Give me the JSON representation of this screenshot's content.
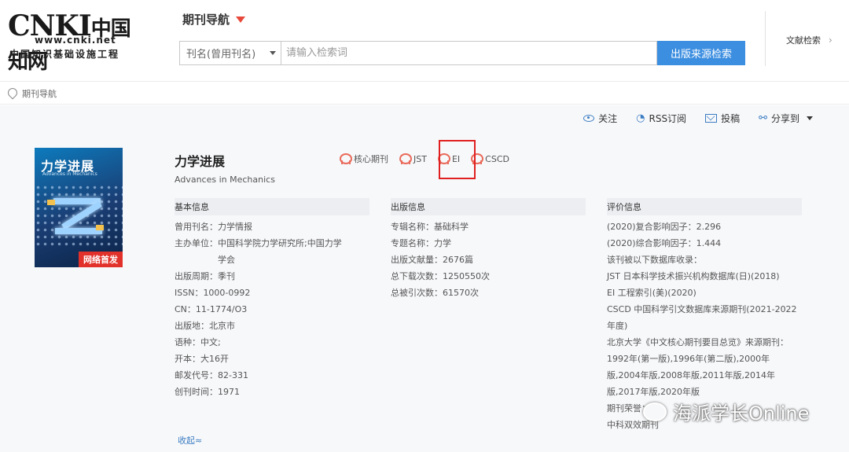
{
  "logo": {
    "brand": "CNKI",
    "brand_cn": "中国知网",
    "url": "www.cnki.net",
    "tagline": "中国知识基础设施工程"
  },
  "header": {
    "nav_title": "期刊导航",
    "search_field": "刊名(曾用刊名)",
    "search_placeholder": "请输入检索词",
    "search_button": "出版来源检索",
    "doc_search": "文献检索"
  },
  "breadcrumb": {
    "item": "期刊导航"
  },
  "actions": [
    {
      "label": "关注",
      "icon": "eye-icon"
    },
    {
      "label": "RSS订阅",
      "icon": "rss-icon"
    },
    {
      "label": "投稿",
      "icon": "mail-icon"
    },
    {
      "label": "分享到",
      "icon": "share-icon"
    }
  ],
  "journal": {
    "title": "力学进展",
    "subtitle": "Advances in Mechanics",
    "cover_title": "力学进展",
    "cover_subtitle": "Advances in Mechanics",
    "cover_badge": "网络首发",
    "badges": [
      "核心期刊",
      "JST",
      "EI",
      "CSCD"
    ]
  },
  "basic": {
    "heading": "基本信息",
    "rows": [
      {
        "k": "曾用刊名：",
        "v": "力学情报"
      },
      {
        "k": "主办单位：",
        "v": "中国科学院力学研究所;中国力学学会"
      },
      {
        "k": "出版周期：",
        "v": "季刊"
      },
      {
        "k": "ISSN：",
        "v": "1000-0992"
      },
      {
        "k": "CN：",
        "v": "11-1774/O3"
      },
      {
        "k": "出版地：",
        "v": "北京市"
      },
      {
        "k": "语种：",
        "v": "中文;"
      },
      {
        "k": "开本：",
        "v": "大16开"
      },
      {
        "k": "邮发代号：",
        "v": "82-331"
      },
      {
        "k": "创刊时间：",
        "v": "1971"
      }
    ]
  },
  "publish": {
    "heading": "出版信息",
    "rows": [
      {
        "k": "专辑名称：",
        "v": "基础科学"
      },
      {
        "k": "专题名称：",
        "v": "力学"
      },
      {
        "k": "出版文献量：",
        "v": "2676篇"
      },
      {
        "k": "总下载次数：",
        "v": "1250550次"
      },
      {
        "k": "总被引次数：",
        "v": "61570次"
      }
    ]
  },
  "evaluation": {
    "heading": "评价信息",
    "lines": [
      "(2020)复合影响因子：2.296",
      "(2020)综合影响因子：1.444",
      "该刊被以下数据库收录：",
      "JST 日本科学技术振兴机构数据库(日)(2018)",
      "EI 工程索引(美)(2020)",
      "CSCD 中国科学引文数据库来源期刊(2021-2022年度)",
      "北京大学《中文核心期刊要目总览》来源期刊：",
      "1992年(第一版),1996年(第二版),2000年版,2004年版,2008年版,2011年版,2014年版,2017年版,2020年版",
      "期刊荣誉：",
      "中科双效期刊"
    ]
  },
  "collapse_label": "收起≈",
  "watermark": "海派学长Online"
}
